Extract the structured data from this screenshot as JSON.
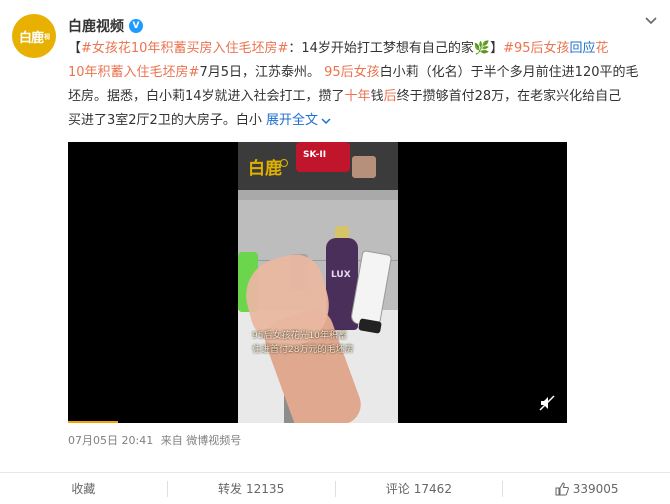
{
  "user": {
    "avatar_text": "白鹿",
    "avatar_sub": "视",
    "name": "白鹿视频",
    "verified_mark": "V"
  },
  "post": {
    "line1_a": "【",
    "topic1": "#女孩花10年积蓄买房入住毛坯房#",
    "line1_b": "：14岁开始打工梦想有自己的家",
    "emoji": "🌿",
    "line1_c": "】",
    "topic2_a": "#95后女孩",
    "topic2_b": "回应",
    "topic2_c": "花",
    "line2_a": "10年积蓄入住毛坯房#",
    "line2_b": "7月5日，江苏泰州。",
    "line2_c": "95后女孩",
    "line2_d": "白小莉（化名）于半个多月前住进120平的毛",
    "line3_a": "坯房。据悉，白小莉14岁就进入社会打工，攒了",
    "line3_b": "十年",
    "line3_c": "钱",
    "line3_d": "后",
    "line3_e": "终于攒够首付28万，在老家兴化给自己",
    "line4_a": "买进了3室2厅2卫的大房子。白小 ",
    "expand": "展开全文",
    "expand_icon": "chevron-down-icon"
  },
  "video": {
    "logo": "白鹿",
    "product_label": "SK-II",
    "lux_label": "LUX",
    "caption_line1": "95后女孩花光10年积蓄",
    "caption_line2": "住进首付28万元的毛坯房",
    "progress_fraction": 0.1
  },
  "meta": {
    "datetime": "07月05日 20:41",
    "source": "来自 微博视频号"
  },
  "footer": {
    "favorite": "收藏",
    "repost_label": "转发",
    "repost_count": "12135",
    "comment_label": "评论",
    "comment_count": "17462",
    "like_count": "339005"
  },
  "colors": {
    "accent": "#eb7350",
    "link": "#1e6fcf",
    "verified": "#1e9bff",
    "avatar": "#e8b000"
  }
}
